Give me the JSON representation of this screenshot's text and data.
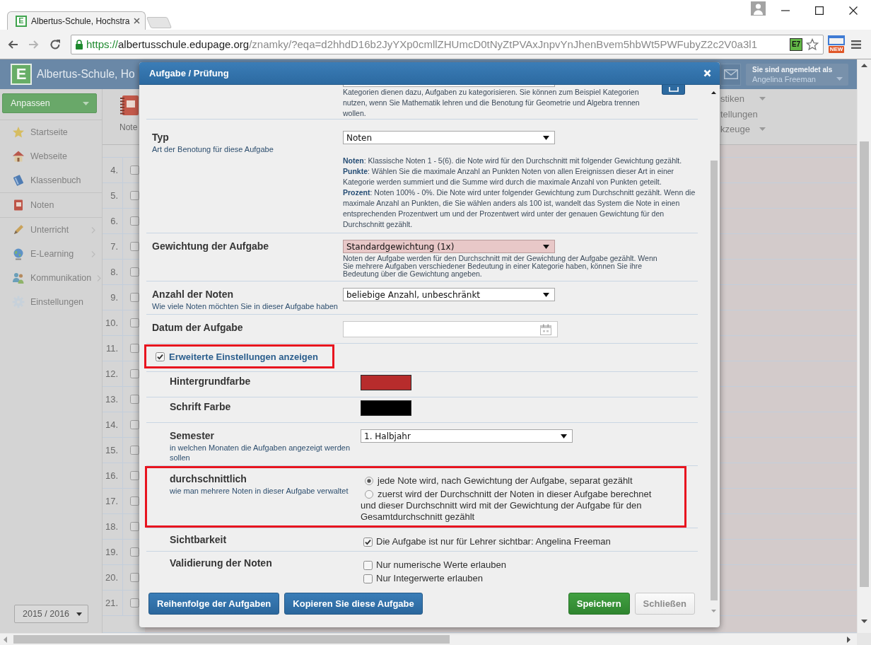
{
  "browser": {
    "tab": {
      "favicon": "E",
      "title": "Albertus-Schule, Hochstra"
    },
    "address": {
      "scheme": "https://",
      "host": "albertusschule.edupage.org",
      "path": "/znamky/?eqa=d2hhdD16b2JyYXp0cmllZHUmcD0tNyZtPVAxJnpvYnJhenBvem5hbWt5PWFubyZ2c2V0a3l1"
    },
    "extension_badge": "E7",
    "new_badge": "NEW"
  },
  "header": {
    "logo": "E",
    "title": "Albertus-Schule, Ho",
    "user": {
      "caption": "Sie sind angemeldet als",
      "name": "Angelina Freeman"
    }
  },
  "sidebar": {
    "button": "Anpassen",
    "groups": [
      {
        "items": [
          {
            "label": "Startseite",
            "expandable": false
          },
          {
            "label": "Webseite",
            "expandable": false
          },
          {
            "label": "Klassenbuch",
            "expandable": false
          }
        ]
      },
      {
        "items": [
          {
            "label": "Noten",
            "expandable": false
          }
        ]
      },
      {
        "items": [
          {
            "label": "Unterricht",
            "expandable": true
          },
          {
            "label": "E-Learning",
            "expandable": true
          },
          {
            "label": "Kommunikation",
            "expandable": true
          },
          {
            "label": "Einstellungen",
            "expandable": false
          }
        ]
      }
    ],
    "year": "2015 / 2016"
  },
  "toolbar": {
    "tool": "Note",
    "menu": [
      {
        "label": "stiken",
        "dropdown": true
      },
      {
        "label": "tellungen",
        "dropdown": false
      },
      {
        "label": "kzeuge",
        "dropdown": true
      }
    ]
  },
  "table": {
    "rows": [
      {
        "number": "4.",
        "checked": false
      },
      {
        "number": "5.",
        "checked": false
      },
      {
        "number": "6.",
        "checked": false
      },
      {
        "number": "7.",
        "checked": false
      },
      {
        "number": "8.",
        "checked": false
      },
      {
        "number": "9.",
        "checked": false
      },
      {
        "number": "10.",
        "checked": false
      },
      {
        "number": "11.",
        "checked": false
      },
      {
        "number": "12.",
        "checked": false
      },
      {
        "number": "13.",
        "checked": false
      },
      {
        "number": "14.",
        "checked": false
      },
      {
        "number": "15.",
        "checked": false
      },
      {
        "number": "16.",
        "checked": false
      },
      {
        "number": "17.",
        "checked": false
      },
      {
        "number": "18.",
        "checked": false
      },
      {
        "number": "19.",
        "checked": false
      },
      {
        "number": "20.",
        "checked": false
      },
      {
        "number": "21.",
        "checked": false
      }
    ]
  },
  "dialog": {
    "title": "Aufgabe / Prüfung",
    "category": {
      "help": "Kategorien dienen dazu, Aufgaben zu kategorisieren. Sie können zum Beispiel Kategorien nutzen, wenn Sie Mathematik lehren und die Benotung für Geometrie und Algebra trennen wollen."
    },
    "rows": [
      {
        "kind": "select",
        "label": "Typ",
        "sublabel": "Art der Benotung für diese Aufgabe",
        "value": "Noten",
        "highlighted": false,
        "outlined": false,
        "help": [
          "**Noten**: Klassische Noten 1 - 5(6). die Note wird für den Durchschnitt mit folgender Gewichtung gezählt.",
          "**Punkte**: Wählen Sie die maximale Anzahl an Punkten Noten von allen Ereignissen dieser Art in einer Kategorie werden summiert und die Summe wird durch die maximale Anzahl von Punkten geteilt.",
          "**Prozent**: Noten 100% - 0%. Die Note wird unter folgender Gewichtung zum Durchschnitt gezählt. Wenn die maximale Anzahl an Punkten, die Sie wählen anders als 100 ist, wandelt das System die Note in einen entsprechenden Prozentwert um und der Prozentwert wird unter der genauen Gewichtung für den Durchschnitt gezählt."
        ]
      },
      {
        "kind": "select",
        "label": "Gewichtung der Aufgabe",
        "value": "Standardgewichtung (1x)",
        "highlighted": true,
        "outlined": false,
        "note": "Noten der Aufgabe werden für den Durchschnitt mit der Gewichtung der Aufgabe gezählt. Wenn Sie mehrere Aufgaben verschiedener Bedeutung in einer Kategorie haben, können Sie ihre Bedeutung über die Gewichtung angeben."
      },
      {
        "kind": "select",
        "label": "Anzahl der Noten",
        "sublabel": "Wie viele Noten möchten Sie in dieser Aufgabe haben",
        "value": "beliebige Anzahl, unbeschränkt",
        "highlighted": false,
        "outlined": false
      },
      {
        "kind": "date",
        "label": "Datum der Aufgabe",
        "outlined": false
      }
    ],
    "advanced": {
      "label": "Erweiterte Einstellungen anzeigen",
      "checked": true,
      "outlined": true,
      "rows": [
        {
          "kind": "swatch",
          "label": "Hintergrundfarbe",
          "color": "#b72c2c",
          "outlined": false
        },
        {
          "kind": "swatch",
          "label": "Schrift Farbe",
          "color": "#000000",
          "outlined": false
        },
        {
          "kind": "select",
          "label": "Semester",
          "sublabel": "in welchen Monaten die Aufgaben angezeigt werden sollen",
          "value": "1. Halbjahr",
          "highlighted": false,
          "outlined": false
        },
        {
          "kind": "radio",
          "label": "durchschnittlich",
          "sublabel": "wie man mehrere Noten in dieser Aufgabe verwaltet",
          "outlined": true,
          "options": [
            {
              "label": "jede Note wird, nach Gewichtung der Aufgabe, separat gezählt",
              "selected": true
            },
            {
              "label": "zuerst wird der Durchschnitt der Noten in dieser Aufgabe berechnet und dieser Durchschnitt wird mit der Gewichtung der Aufgabe für den Gesamtdurchschnitt gezählt",
              "selected": false
            }
          ]
        },
        {
          "kind": "checks",
          "label": "Sichtbarkeit",
          "outlined": false,
          "options": [
            {
              "label": "Die Aufgabe ist nur für Lehrer sichtbar: Angelina Freeman",
              "checked": true
            }
          ]
        },
        {
          "kind": "checks",
          "label": "Validierung der Noten",
          "outlined": false,
          "options": [
            {
              "label": "Nur numerische Werte erlauben",
              "checked": false
            },
            {
              "label": "Nur Integerwerte erlauben",
              "checked": false
            }
          ]
        }
      ]
    },
    "buttons": {
      "left": [
        {
          "label": "Reihenfolge der Aufgaben",
          "kind": "primary"
        },
        {
          "label": "Kopieren Sie diese Aufgabe",
          "kind": "primary"
        }
      ],
      "right": [
        {
          "label": "Speichern",
          "kind": "success"
        },
        {
          "label": "Schließen",
          "kind": "default"
        }
      ]
    }
  }
}
